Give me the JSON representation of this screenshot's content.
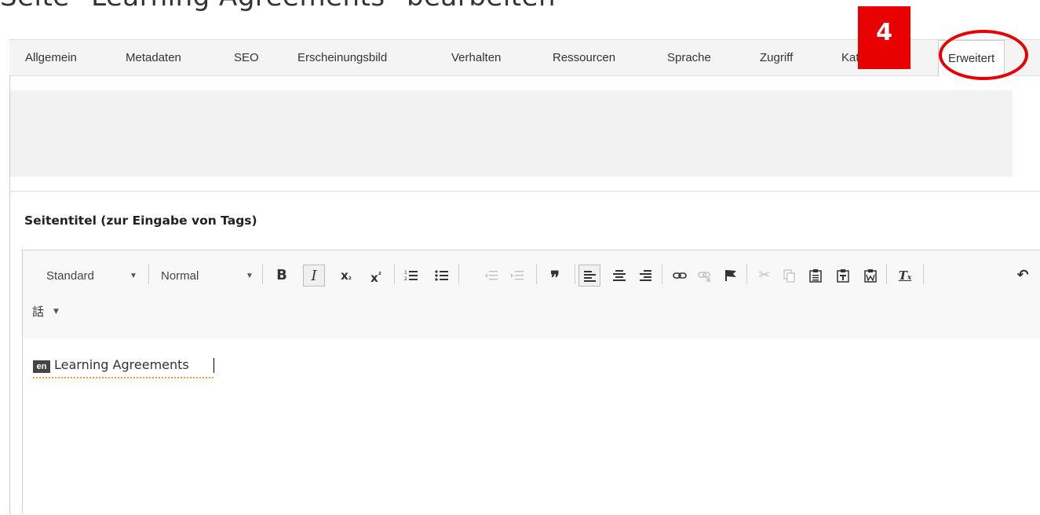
{
  "page": {
    "title": "Seite \"Learning Agreements\" bearbeiten"
  },
  "tabs": [
    {
      "label": "Allgemein"
    },
    {
      "label": "Metadaten"
    },
    {
      "label": "SEO"
    },
    {
      "label": "Erscheinungsbild"
    },
    {
      "label": "Verhalten"
    },
    {
      "label": "Ressourcen"
    },
    {
      "label": "Sprache"
    },
    {
      "label": "Zugriff"
    },
    {
      "label": "Kategorien"
    },
    {
      "label": "Erweitert",
      "active": true
    }
  ],
  "annotation": {
    "label": "4",
    "color": "#e80000"
  },
  "field": {
    "label": "Seitentitel (zur Eingabe von Tags)"
  },
  "toolbar": {
    "style_select": "Standard",
    "format_select": "Normal",
    "language_button": "話"
  },
  "editor": {
    "language_badge": "en",
    "content": "Learning Agreements"
  }
}
